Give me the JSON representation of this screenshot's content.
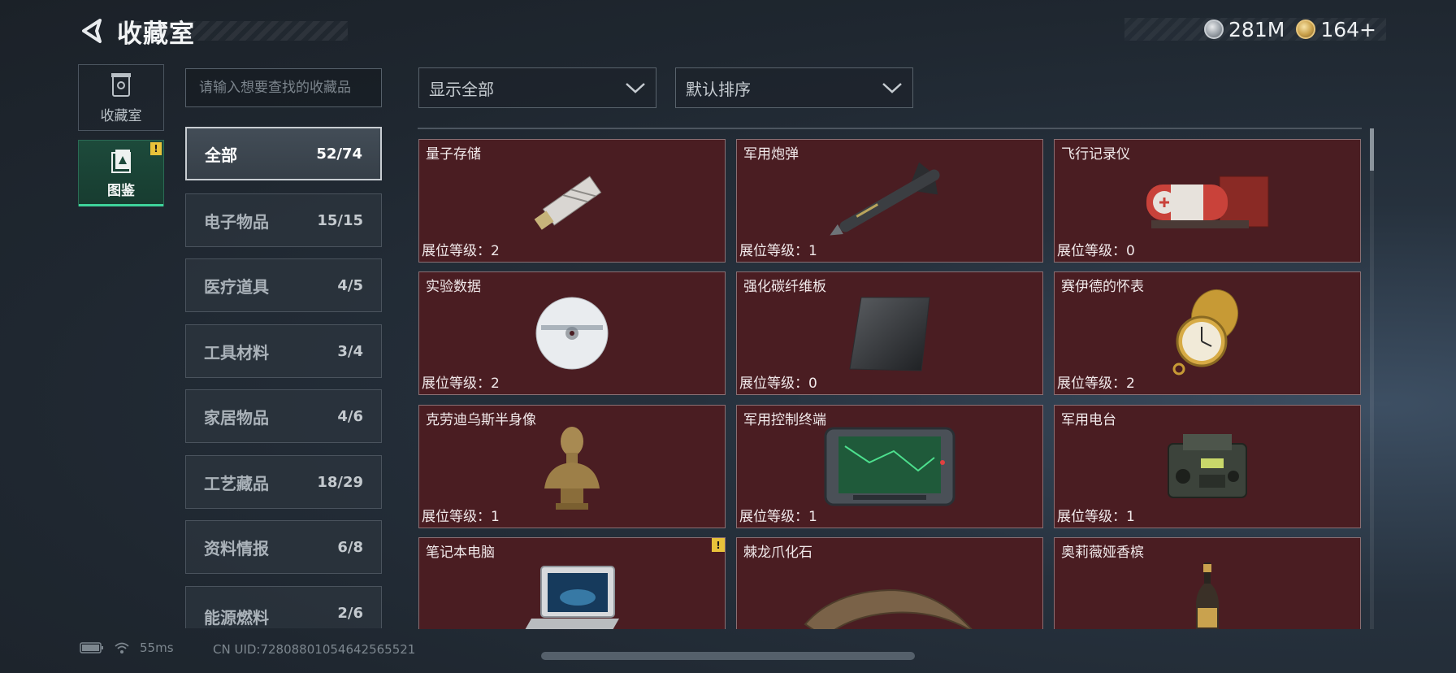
{
  "header": {
    "title": "收藏室",
    "currencies": [
      {
        "icon": "silver-coin-icon",
        "value": "281M"
      },
      {
        "icon": "gold-coin-icon",
        "value": "164+"
      }
    ]
  },
  "side_tabs": [
    {
      "label": "收藏室",
      "icon": "collection-room-icon",
      "active": false
    },
    {
      "label": "图鉴",
      "icon": "catalog-book-icon",
      "active": true,
      "badge": "!"
    }
  ],
  "search": {
    "placeholder": "请输入想要查找的收藏品",
    "value": ""
  },
  "categories": [
    {
      "name": "全部",
      "count": "52/74",
      "active": true
    },
    {
      "name": "电子物品",
      "count": "15/15"
    },
    {
      "name": "医疗道具",
      "count": "4/5"
    },
    {
      "name": "工具材料",
      "count": "3/4"
    },
    {
      "name": "家居物品",
      "count": "4/6"
    },
    {
      "name": "工艺藏品",
      "count": "18/29"
    },
    {
      "name": "资料情报",
      "count": "6/8"
    },
    {
      "name": "能源燃料",
      "count": "2/6"
    }
  ],
  "filters": {
    "display": {
      "value": "显示全部",
      "icon": "chevron-down-icon"
    },
    "sort": {
      "value": "默认排序",
      "icon": "chevron-down-icon"
    }
  },
  "items": [
    {
      "name": "量子存储",
      "level": "展位等级：2",
      "icon": "quantum-storage-icon"
    },
    {
      "name": "军用炮弹",
      "level": "展位等级：1",
      "icon": "missile-icon"
    },
    {
      "name": "飞行记录仪",
      "level": "展位等级：0",
      "icon": "flight-recorder-icon"
    },
    {
      "name": "实验数据",
      "level": "展位等级：2",
      "icon": "data-disc-icon"
    },
    {
      "name": "强化碳纤维板",
      "level": "展位等级：0",
      "icon": "carbon-plate-icon"
    },
    {
      "name": "赛伊德的怀表",
      "level": "展位等级：2",
      "icon": "pocket-watch-icon"
    },
    {
      "name": "克劳迪乌斯半身像",
      "level": "展位等级：1",
      "icon": "bust-statue-icon"
    },
    {
      "name": "军用控制终端",
      "level": "展位等级：1",
      "icon": "control-terminal-icon"
    },
    {
      "name": "军用电台",
      "level": "展位等级：1",
      "icon": "radio-icon"
    },
    {
      "name": "笔记本电脑",
      "level": "",
      "icon": "laptop-icon",
      "badge": "!"
    },
    {
      "name": "棘龙爪化石",
      "level": "",
      "icon": "claw-fossil-icon"
    },
    {
      "name": "奥莉薇娅香槟",
      "level": "",
      "icon": "champagne-icon"
    }
  ],
  "footer": {
    "ping": "55ms",
    "uid": "CN UID:72808801054642565521"
  }
}
